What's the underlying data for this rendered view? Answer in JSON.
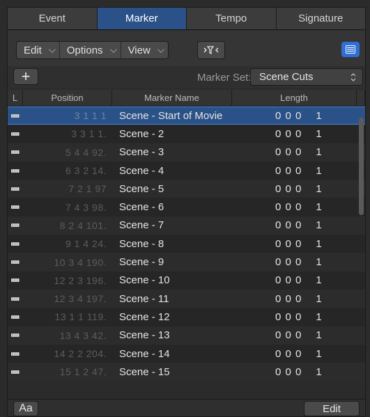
{
  "tabs": [
    {
      "label": "Event",
      "active": false
    },
    {
      "label": "Marker",
      "active": true
    },
    {
      "label": "Tempo",
      "active": false
    },
    {
      "label": "Signature",
      "active": false
    }
  ],
  "toolbar": {
    "edit_label": "Edit",
    "options_label": "Options",
    "view_label": "View",
    "filter_icon": "filter-icon",
    "list_icon": "list-view-icon"
  },
  "marker_set": {
    "add_label": "+",
    "label": "Marker Set:",
    "value": "Scene Cuts"
  },
  "table": {
    "headers": {
      "l": "L",
      "position": "Position",
      "name": "Marker Name",
      "length": "Length"
    },
    "rows": [
      {
        "pos": "3 1 1      1",
        "name": "Scene - Start of Movie",
        "len_a": "0 0 0",
        "len_b": "1",
        "selected": true
      },
      {
        "pos": "3 3 1      1.",
        "name": "Scene - 2",
        "len_a": "0 0 0",
        "len_b": "1"
      },
      {
        "pos": "5 4 4    92.",
        "name": "Scene - 3",
        "len_a": "0 0 0",
        "len_b": "1"
      },
      {
        "pos": "6 3 2    14.",
        "name": "Scene - 4",
        "len_a": "0 0 0",
        "len_b": "1"
      },
      {
        "pos": "7 2 1    97",
        "name": "Scene - 5",
        "len_a": "0 0 0",
        "len_b": "1"
      },
      {
        "pos": "7 4 3    98.",
        "name": "Scene - 6",
        "len_a": "0 0 0",
        "len_b": "1"
      },
      {
        "pos": "8 2 4 101.",
        "name": "Scene - 7",
        "len_a": "0 0 0",
        "len_b": "1"
      },
      {
        "pos": "9 1 4    24.",
        "name": "Scene - 8",
        "len_a": "0 0 0",
        "len_b": "1"
      },
      {
        "pos": "10 3 4 190.",
        "name": "Scene - 9",
        "len_a": "0 0 0",
        "len_b": "1"
      },
      {
        "pos": "12 2 3 196.",
        "name": "Scene - 10",
        "len_a": "0 0 0",
        "len_b": "1"
      },
      {
        "pos": "12 3 4 197.",
        "name": "Scene - 11",
        "len_a": "0 0 0",
        "len_b": "1"
      },
      {
        "pos": "13 1 1 119.",
        "name": "Scene - 12",
        "len_a": "0 0 0",
        "len_b": "1"
      },
      {
        "pos": "13 4 3    42.",
        "name": "Scene - 13",
        "len_a": "0 0 0",
        "len_b": "1"
      },
      {
        "pos": "14 2 2 204.",
        "name": "Scene - 14",
        "len_a": "0 0 0",
        "len_b": "1"
      },
      {
        "pos": "15 1 2    47.",
        "name": "Scene - 15",
        "len_a": "0 0 0",
        "len_b": "1"
      }
    ]
  },
  "bottom": {
    "font_label": "Aa",
    "edit_label": "Edit"
  },
  "colors": {
    "accent": "#2b5288",
    "list_button": "#2f6fd6"
  }
}
